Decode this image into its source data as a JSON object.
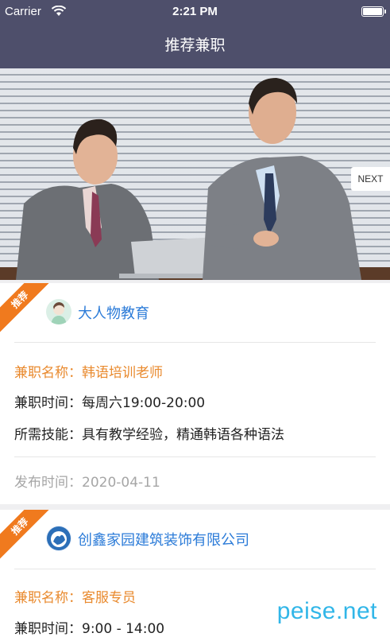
{
  "status_bar": {
    "carrier": "Carrier",
    "time": "2:21 PM"
  },
  "nav": {
    "title": "推荐兼职"
  },
  "banner": {
    "next_label": "NEXT"
  },
  "jobs": [
    {
      "badge": "推荐",
      "company": "大人物教育",
      "name_label": "兼职名称：",
      "name": "韩语培训老师",
      "time_label": "兼职时间：",
      "time": "每周六19:00-20:00",
      "skill_label": "所需技能：",
      "skill": "具有教学经验，精通韩语各种语法",
      "publish_label": "发布时间：",
      "publish": "2020-04-11"
    },
    {
      "badge": "推荐",
      "company": "创鑫家园建筑装饰有限公司",
      "name_label": "兼职名称：",
      "name": "客服专员",
      "time_label": "兼职时间：",
      "time": "9:00 - 14:00"
    }
  ],
  "watermark": "peise.net",
  "colors": {
    "nav_bg": "#4e4f6b",
    "accent_orange": "#f07a1e",
    "link_blue": "#2b7bd8"
  }
}
